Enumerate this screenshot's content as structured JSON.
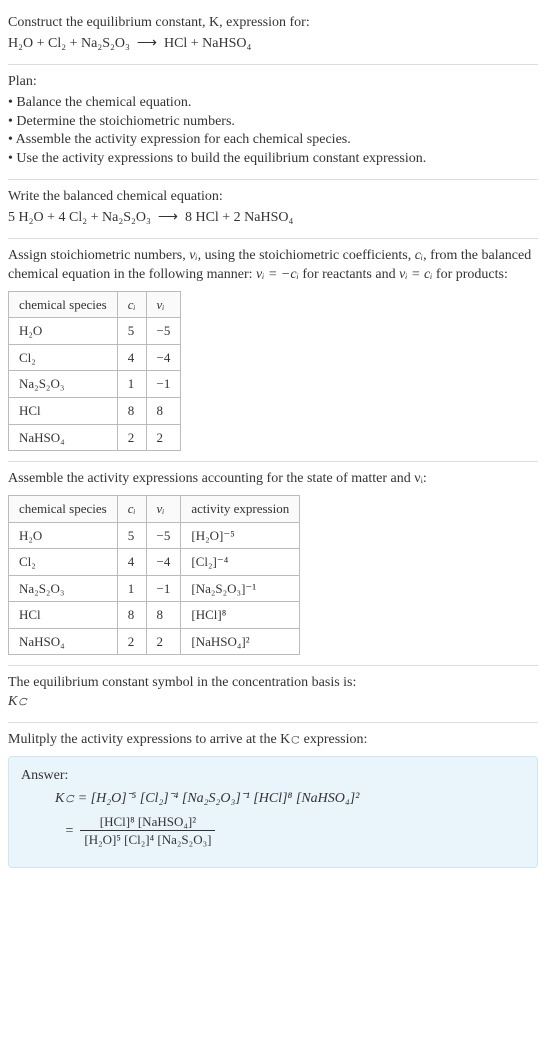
{
  "intro": {
    "line1": "Construct the equilibrium constant, K, expression for:",
    "equation_lhs": "H₂O + Cl₂ + Na₂S₂O₃",
    "arrow": "⟶",
    "equation_rhs": "HCl + NaHSO₄"
  },
  "plan": {
    "heading": "Plan:",
    "items": [
      "Balance the chemical equation.",
      "Determine the stoichiometric numbers.",
      "Assemble the activity expression for each chemical species.",
      "Use the activity expressions to build the equilibrium constant expression."
    ]
  },
  "balanced": {
    "heading": "Write the balanced chemical equation:",
    "lhs": "5 H₂O + 4 Cl₂ + Na₂S₂O₃",
    "arrow": "⟶",
    "rhs": "8 HCl + 2 NaHSO₄"
  },
  "stoich": {
    "text_a": "Assign stoichiometric numbers, ",
    "nu_i": "νᵢ",
    "text_b": ", using the stoichiometric coefficients, ",
    "c_i": "cᵢ",
    "text_c": ", from the balanced chemical equation in the following manner: ",
    "rel1": "νᵢ = −cᵢ",
    "text_d": " for reactants and ",
    "rel2": "νᵢ = cᵢ",
    "text_e": " for products:",
    "headers": [
      "chemical species",
      "cᵢ",
      "νᵢ"
    ],
    "rows": [
      [
        "H₂O",
        "5",
        "−5"
      ],
      [
        "Cl₂",
        "4",
        "−4"
      ],
      [
        "Na₂S₂O₃",
        "1",
        "−1"
      ],
      [
        "HCl",
        "8",
        "8"
      ],
      [
        "NaHSO₄",
        "2",
        "2"
      ]
    ]
  },
  "activity": {
    "heading": "Assemble the activity expressions accounting for the state of matter and νᵢ:",
    "headers": [
      "chemical species",
      "cᵢ",
      "νᵢ",
      "activity expression"
    ],
    "rows": [
      [
        "H₂O",
        "5",
        "−5",
        "[H₂O]⁻⁵"
      ],
      [
        "Cl₂",
        "4",
        "−4",
        "[Cl₂]⁻⁴"
      ],
      [
        "Na₂S₂O₃",
        "1",
        "−1",
        "[Na₂S₂O₃]⁻¹"
      ],
      [
        "HCl",
        "8",
        "8",
        "[HCl]⁸"
      ],
      [
        "NaHSO₄",
        "2",
        "2",
        "[NaHSO₄]²"
      ]
    ]
  },
  "symbol": {
    "line1": "The equilibrium constant symbol in the concentration basis is:",
    "kc": "K𝚌"
  },
  "multiply": {
    "heading": "Mulitply the activity expressions to arrive at the K𝚌 expression:"
  },
  "answer": {
    "label": "Answer:",
    "kc_eq": "K𝚌 = [H₂O]⁻⁵ [Cl₂]⁻⁴ [Na₂S₂O₃]⁻¹ [HCl]⁸ [NaHSO₄]²",
    "frac_num": "[HCl]⁸ [NaHSO₄]²",
    "frac_den": "[H₂O]⁵ [Cl₂]⁴ [Na₂S₂O₃]",
    "eq_sign": "="
  },
  "chart_data": {
    "type": "table",
    "tables": [
      {
        "title": "stoichiometric numbers",
        "headers": [
          "chemical species",
          "c_i",
          "nu_i"
        ],
        "rows": [
          {
            "species": "H2O",
            "c_i": 5,
            "nu_i": -5
          },
          {
            "species": "Cl2",
            "c_i": 4,
            "nu_i": -4
          },
          {
            "species": "Na2S2O3",
            "c_i": 1,
            "nu_i": -1
          },
          {
            "species": "HCl",
            "c_i": 8,
            "nu_i": 8
          },
          {
            "species": "NaHSO4",
            "c_i": 2,
            "nu_i": 2
          }
        ]
      },
      {
        "title": "activity expressions",
        "headers": [
          "chemical species",
          "c_i",
          "nu_i",
          "activity expression"
        ],
        "rows": [
          {
            "species": "H2O",
            "c_i": 5,
            "nu_i": -5,
            "activity": "[H2O]^-5"
          },
          {
            "species": "Cl2",
            "c_i": 4,
            "nu_i": -4,
            "activity": "[Cl2]^-4"
          },
          {
            "species": "Na2S2O3",
            "c_i": 1,
            "nu_i": -1,
            "activity": "[Na2S2O3]^-1"
          },
          {
            "species": "HCl",
            "c_i": 8,
            "nu_i": 8,
            "activity": "[HCl]^8"
          },
          {
            "species": "NaHSO4",
            "c_i": 2,
            "nu_i": 2,
            "activity": "[NaHSO4]^2"
          }
        ]
      }
    ]
  }
}
